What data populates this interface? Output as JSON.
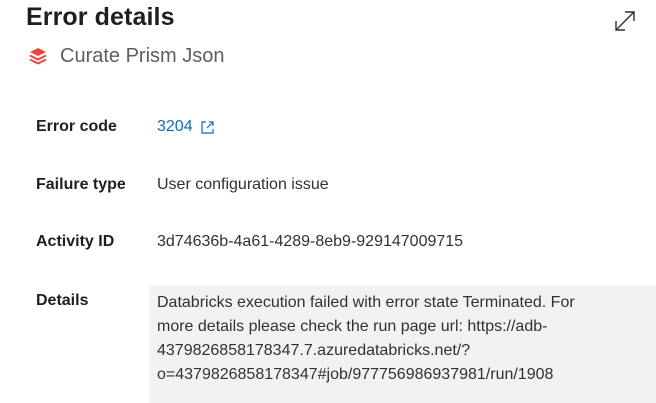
{
  "header": {
    "title": "Error details",
    "activity_name": "Curate Prism Json",
    "expand_icon": "expand-diagonal-icon",
    "activity_icon": "databricks-layers-icon"
  },
  "fields": {
    "error_code": {
      "label": "Error code",
      "value": "3204",
      "link_icon": "open-external-icon"
    },
    "failure_type": {
      "label": "Failure type",
      "value": "User configuration issue"
    },
    "activity_id": {
      "label": "Activity ID",
      "value": "3d74636b-4a61-4289-8eb9-929147009715"
    },
    "details": {
      "label": "Details",
      "lines": [
        "Databricks execution failed with error state Terminated. For",
        "more details please check the run page url: https://adb-",
        "4379826858178347.7.azuredatabricks.net/?",
        "o=4379826858178347#job/977756986937981/run/1908"
      ]
    }
  },
  "colors": {
    "link": "#0f6cbd",
    "databricks_red": "#e8473c",
    "details_background": "#f3f2f1",
    "label_text": "#201f1e",
    "secondary_text": "#605e5c"
  }
}
